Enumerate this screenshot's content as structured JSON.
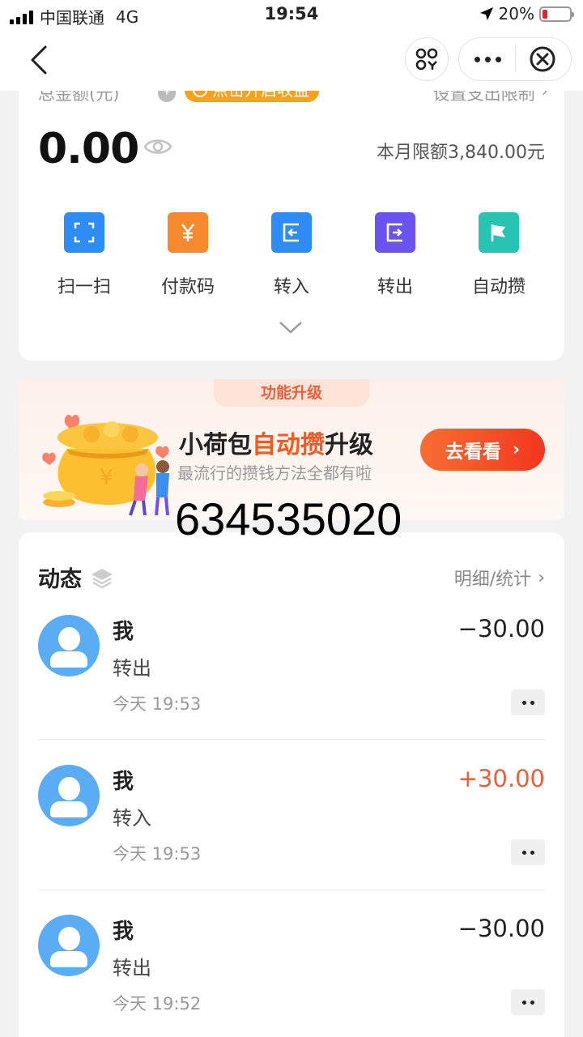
{
  "status": {
    "carrier": "中国联通",
    "network": "4G",
    "time": "19:54",
    "battery": "20%",
    "battery_level": 0.2
  },
  "balance": {
    "label": "总金额(元)",
    "badge": "点击开启收益",
    "limit_link": "设置支出限制",
    "amount": "0.00",
    "monthly_limit": "本月限额3,840.00元"
  },
  "actions": [
    {
      "label": "扫一扫",
      "icon": "scan-icon",
      "color": "#2e8cf5"
    },
    {
      "label": "付款码",
      "icon": "yuan-icon",
      "color": "#f7892d"
    },
    {
      "label": "转入",
      "icon": "transfer-in-icon",
      "color": "#2e8cf5"
    },
    {
      "label": "转出",
      "icon": "transfer-out-icon",
      "color": "#6b53ef"
    },
    {
      "label": "自动攒",
      "icon": "flag-icon",
      "color": "#27c4b4"
    }
  ],
  "promo": {
    "tab": "功能升级",
    "title_prefix": "小荷包",
    "title_highlight": "自动攒",
    "title_suffix": "升级",
    "subtitle": "最流行的攒钱方法全都有啦",
    "button": "去看看"
  },
  "overlay_text": "634535020",
  "activity": {
    "title": "动态",
    "link": "明细/统计",
    "records": [
      {
        "name": "我",
        "type": "转出",
        "time": "今天 19:53",
        "amount": "−30.00",
        "direction": "out"
      },
      {
        "name": "我",
        "type": "转入",
        "time": "今天 19:53",
        "amount": "+30.00",
        "direction": "in"
      },
      {
        "name": "我",
        "type": "转出",
        "time": "今天 19:52",
        "amount": "−30.00",
        "direction": "out"
      }
    ]
  }
}
